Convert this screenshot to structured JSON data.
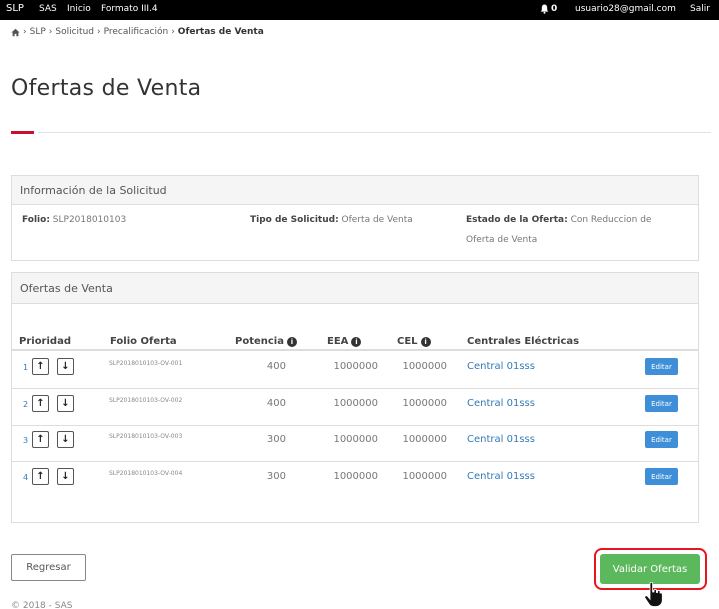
{
  "navbar": {
    "brand": "SLP",
    "links": [
      "SAS",
      "Inicio",
      "Formato III.4"
    ],
    "notification_count": "0",
    "user_email": "usuario28@gmail.com",
    "logout": "Salir"
  },
  "breadcrumb": {
    "home_icon": "home-icon",
    "items": [
      "SLP",
      "Solicitud",
      "Precalificación"
    ],
    "current": "Ofertas de Venta"
  },
  "page_title": "Ofertas de Venta",
  "info_panel": {
    "heading": "Información de la Solicitud",
    "folio_label": "Folio:",
    "folio_value": "SLP2018010103",
    "tipo_label": "Tipo de Solicitud:",
    "tipo_value": "Oferta de Venta",
    "estado_label": "Estado de la Oferta:",
    "estado_value_line1": "Con Reduccion de",
    "estado_value_line2": "Oferta de Venta"
  },
  "ofertas_panel": {
    "heading": "Ofertas de Venta",
    "columns": [
      "Prioridad",
      "Folio Oferta",
      "Potencia",
      "EEA",
      "CEL",
      "Centrales Eléctricas"
    ],
    "rows": [
      {
        "prioridad": "1",
        "folio": "SLP2018010103-OV-001",
        "potencia": "400",
        "eea": "1000000",
        "cel": "1000000",
        "central": "Central 01sss",
        "action": "Editar"
      },
      {
        "prioridad": "2",
        "folio": "SLP2018010103-OV-002",
        "potencia": "400",
        "eea": "1000000",
        "cel": "1000000",
        "central": "Central 01sss",
        "action": "Editar"
      },
      {
        "prioridad": "3",
        "folio": "SLP2018010103-OV-003",
        "potencia": "300",
        "eea": "1000000",
        "cel": "1000000",
        "central": "Central 01sss",
        "action": "Editar"
      },
      {
        "prioridad": "4",
        "folio": "SLP2018010103-OV-004",
        "potencia": "300",
        "eea": "1000000",
        "cel": "1000000",
        "central": "Central 01sss",
        "action": "Editar"
      }
    ]
  },
  "actions": {
    "regresar": "Regresar",
    "validar": "Validar Ofertas"
  },
  "footer": {
    "copyright": "© 2018 - SAS"
  },
  "colors": {
    "accent_red": "#c8102e",
    "link_blue": "#337ab7",
    "editar_blue": "#3f8fd8",
    "validar_green": "#5cb85c",
    "highlight_red": "#e8141e"
  }
}
